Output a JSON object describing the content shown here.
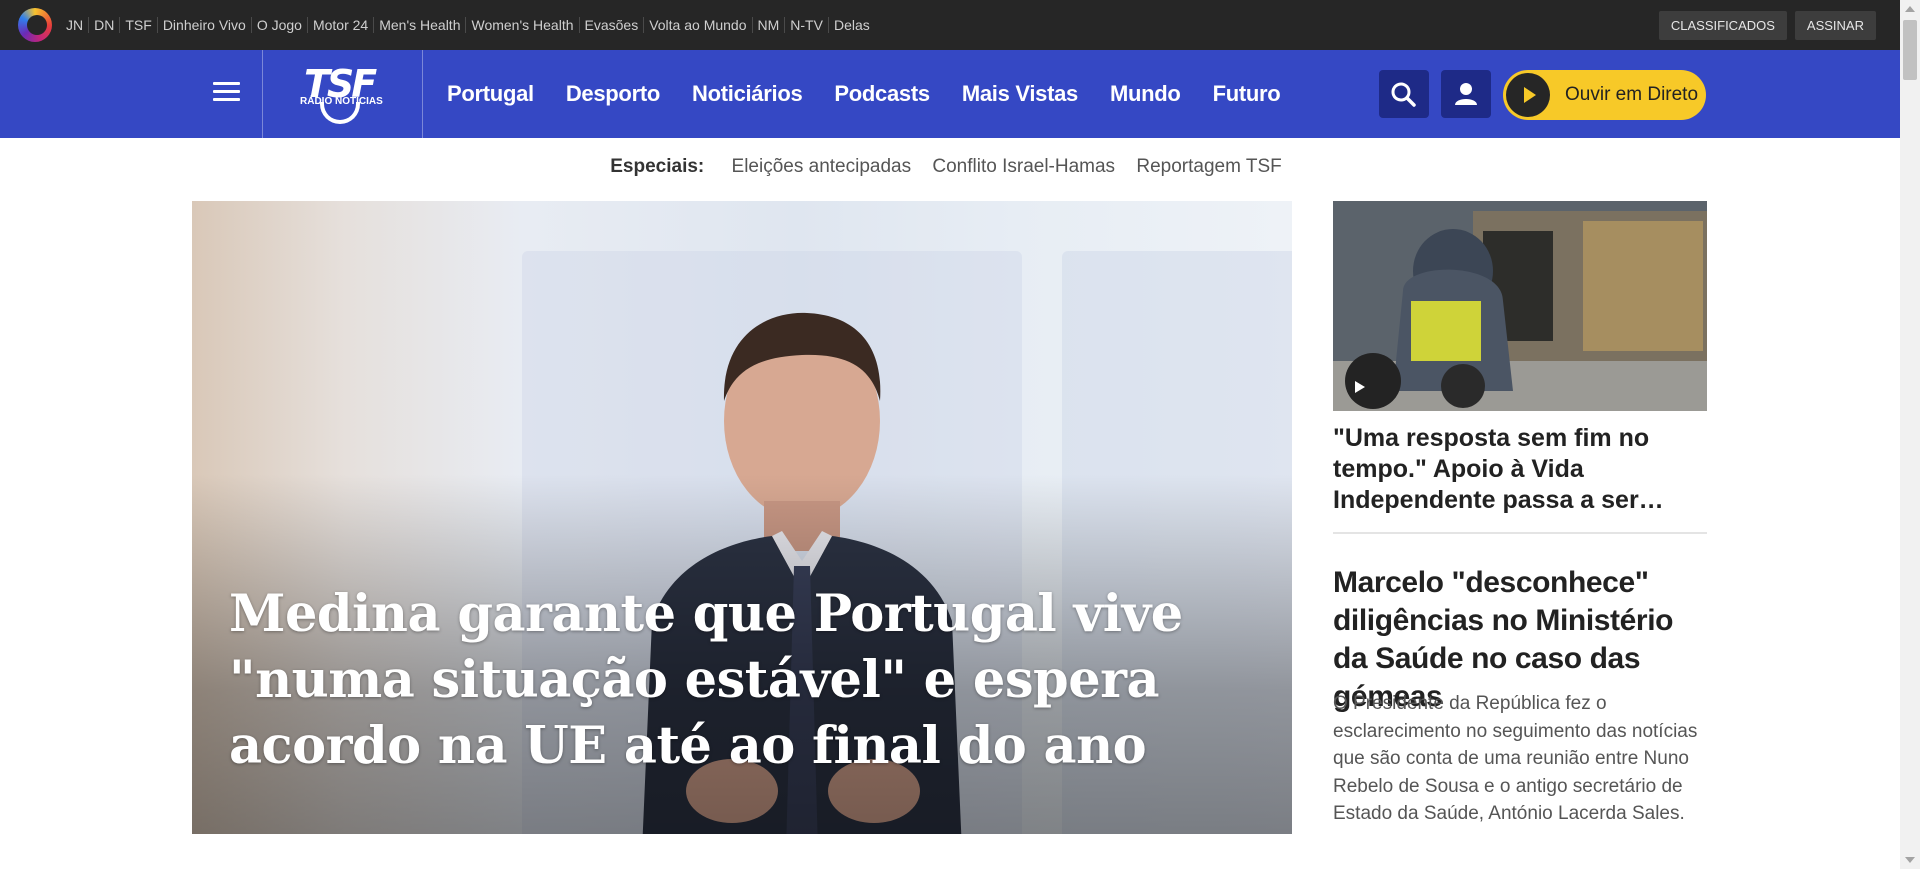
{
  "topbar": {
    "brands": [
      "JN",
      "DN",
      "TSF",
      "Dinheiro Vivo",
      "O Jogo",
      "Motor 24",
      "Men's Health",
      "Women's Health",
      "Evasões",
      "Volta ao Mundo",
      "NM",
      "N-TV",
      "Delas"
    ],
    "classificados": "CLASSIFICADOS",
    "assinar": "ASSINAR"
  },
  "logo": {
    "main": "TSF",
    "sub": "RÁDIO NOTÍCIAS"
  },
  "nav": {
    "items": [
      "Portugal",
      "Desporto",
      "Noticiários",
      "Podcasts",
      "Mais Vistas",
      "Mundo",
      "Futuro"
    ],
    "live_label": "Ouvir em Direto"
  },
  "specials": {
    "label": "Especiais:",
    "links": [
      "Eleições antecipadas",
      "Conflito Israel-Hamas",
      "Reportagem TSF"
    ]
  },
  "hero": {
    "title": "Medina garante que Portugal vive \"numa situação estável\" e espera acordo na UE até ao final do ano"
  },
  "side": {
    "story1_title": "\"Uma resposta sem fim no tempo.\" Apoio à Vida Independente passa a ser…",
    "story2_title": "Marcelo \"desconhece\" diligências no Ministério da Saúde no caso das gémeas",
    "story2_lead": "O Presidente da República fez o esclarecimento no seguimento das notícias que são conta de uma reunião entre Nuno Rebelo de Sousa e o antigo secretário de Estado da Saúde, António Lacerda Sales."
  },
  "colors": {
    "nav_blue": "#3548c4",
    "live_yellow": "#f7c928",
    "topbar": "#262626"
  }
}
